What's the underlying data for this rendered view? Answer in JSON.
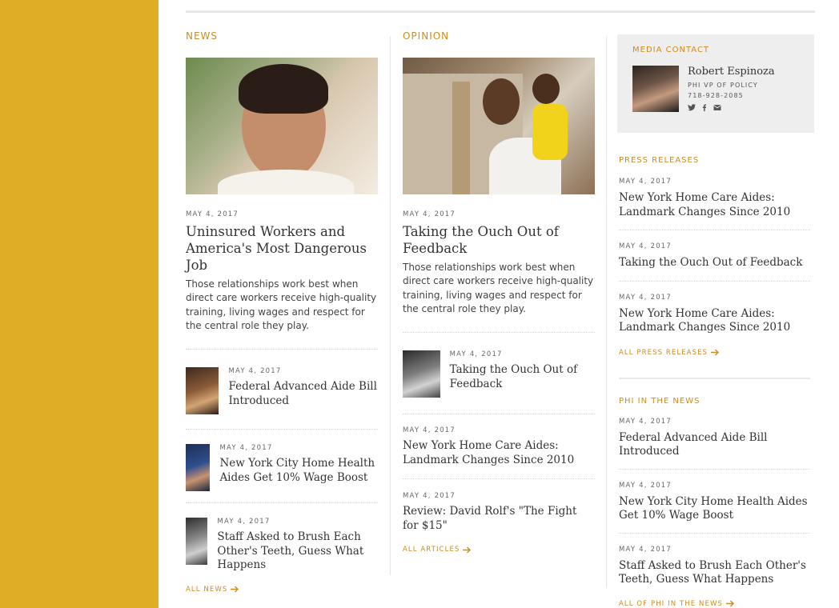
{
  "news": {
    "label": "NEWS",
    "feature": {
      "date": "MAY 4, 2017",
      "title": "Uninsured Workers and America's Most Dangerous Job",
      "excerpt": "Those relationships work best when direct care workers receive high-quality training, living wages and respect for the central role they play."
    },
    "items": [
      {
        "date": "MAY 4, 2017",
        "title": "Federal Advanced Aide Bill Introduced"
      },
      {
        "date": "MAY 4, 2017",
        "title": "New York City Home Health Aides Get 10% Wage Boost"
      },
      {
        "date": "MAY 4, 2017",
        "title": "Staff Asked to Brush Each Other's Teeth, Guess What Happens"
      }
    ],
    "all_link": "ALL NEWS"
  },
  "opinion": {
    "label": "OPINION",
    "feature": {
      "date": "MAY 4, 2017",
      "title": "Taking the Ouch Out of Feedback",
      "excerpt": "Those relationships work best when direct care workers receive high-quality training, living wages and respect for the central role they play."
    },
    "thumb_item": {
      "date": "MAY 4, 2017",
      "title": "Taking the Ouch Out of Feedback"
    },
    "items": [
      {
        "date": "MAY 4, 2017",
        "title": "New York Home Care Aides: Landmark Changes Since 2010"
      },
      {
        "date": "MAY 4, 2017",
        "title": "Review: David Rolf's \"The Fight for $15\""
      }
    ],
    "all_link": "ALL ARTICLES"
  },
  "media_contact": {
    "label": "MEDIA CONTACT",
    "name": "Robert Espinoza",
    "role": "PHI VP OF POLICY",
    "phone": "718-928-2085",
    "social": [
      "twitter-icon",
      "facebook-icon",
      "email-icon"
    ]
  },
  "press_releases": {
    "label": "PRESS RELEASES",
    "items": [
      {
        "date": "MAY 4, 2017",
        "title": "New York Home Care Aides: Landmark Changes Since 2010"
      },
      {
        "date": "MAY 4, 2017",
        "title": "Taking the Ouch Out of Feedback"
      },
      {
        "date": "MAY 4, 2017",
        "title": "New York Home Care Aides: Landmark Changes Since 2010"
      }
    ],
    "all_link": "ALL PRESS RELEASES"
  },
  "phi_in_news": {
    "label": "PHI IN THE NEWS",
    "items": [
      {
        "date": "MAY 4, 2017",
        "title": "Federal Advanced Aide Bill Introduced"
      },
      {
        "date": "MAY 4, 2017",
        "title": "New York City Home Health Aides Get 10% Wage Boost"
      },
      {
        "date": "MAY 4, 2017",
        "title": "Staff Asked to Brush Each Other's Teeth, Guess What Happens"
      }
    ],
    "all_link": "ALL OF PHI IN THE NEWS"
  },
  "colors": {
    "accent": "#cf8a1d",
    "band": "#dfae24",
    "panel": "#eeeeee"
  }
}
